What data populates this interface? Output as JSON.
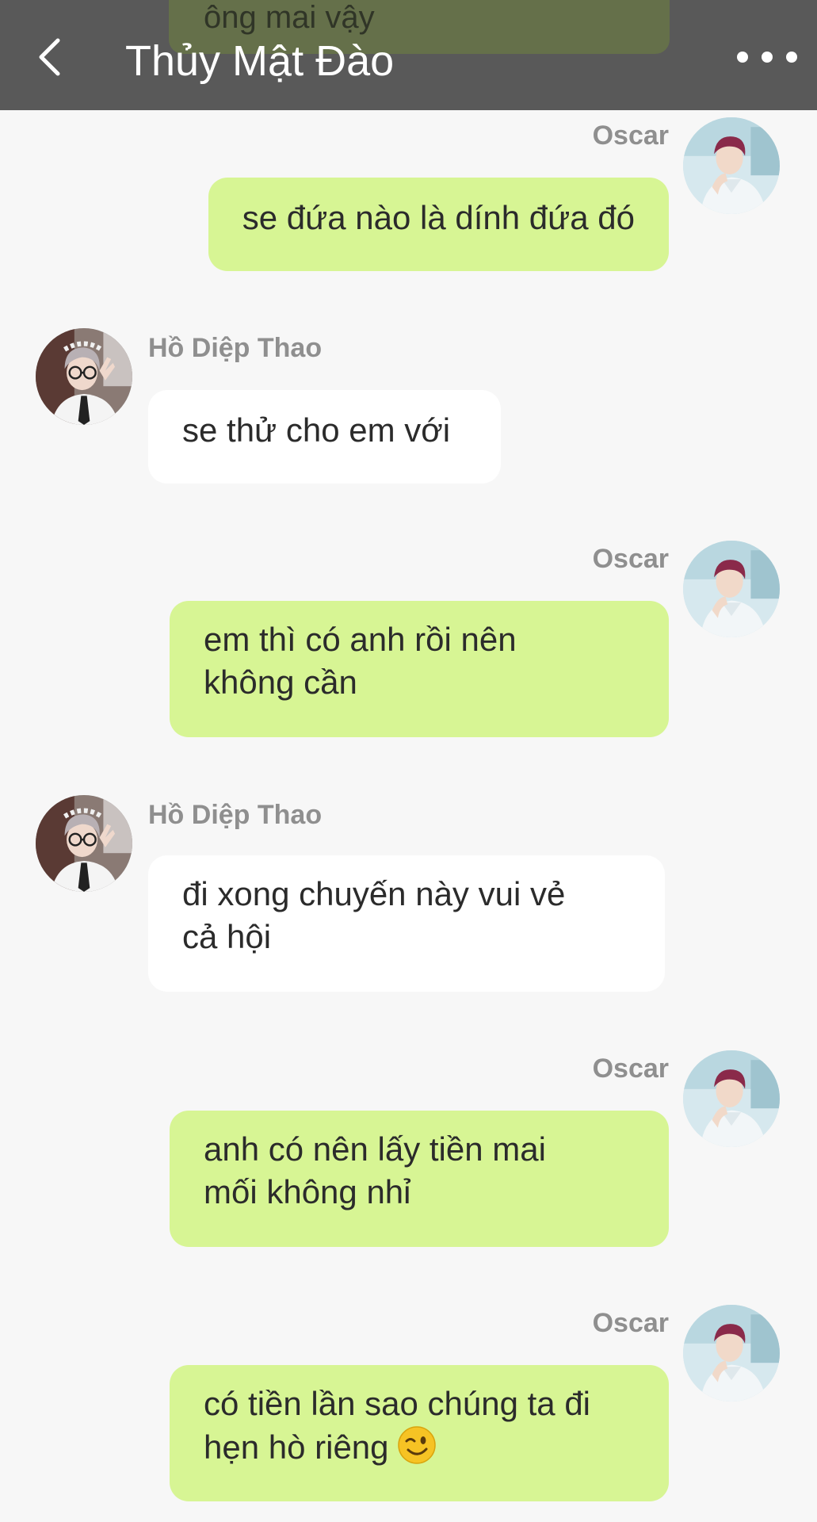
{
  "header": {
    "title": "Thủy Mật Đào",
    "peek_text": "ông mai vậy"
  },
  "messages": [
    {
      "sender": "Oscar",
      "side": "right",
      "text": "se đứa nào là dính đứa đó"
    },
    {
      "sender": "Hồ Diệp Thao",
      "side": "left",
      "text": "se thử cho em với"
    },
    {
      "sender": "Oscar",
      "side": "right",
      "lines": [
        "em thì có anh rồi nên",
        "không cần"
      ]
    },
    {
      "sender": "Hồ Diệp Thao",
      "side": "left",
      "lines": [
        "đi xong chuyến này vui vẻ",
        "cả hội"
      ]
    },
    {
      "sender": "Oscar",
      "side": "right",
      "lines": [
        "anh có nên lấy tiền mai",
        "mối không nhỉ"
      ]
    },
    {
      "sender": "Oscar",
      "side": "right",
      "lines": [
        "có tiền lần sao chúng ta đi",
        "hẹn hò riêng"
      ],
      "emoji": "winking-face"
    }
  ],
  "colors": {
    "header_bg": "#595959",
    "page_bg": "#f7f7f7",
    "sent_bubble": "#d7f594",
    "received_bubble": "#ffffff",
    "sender_name": "#8f8f8f"
  }
}
